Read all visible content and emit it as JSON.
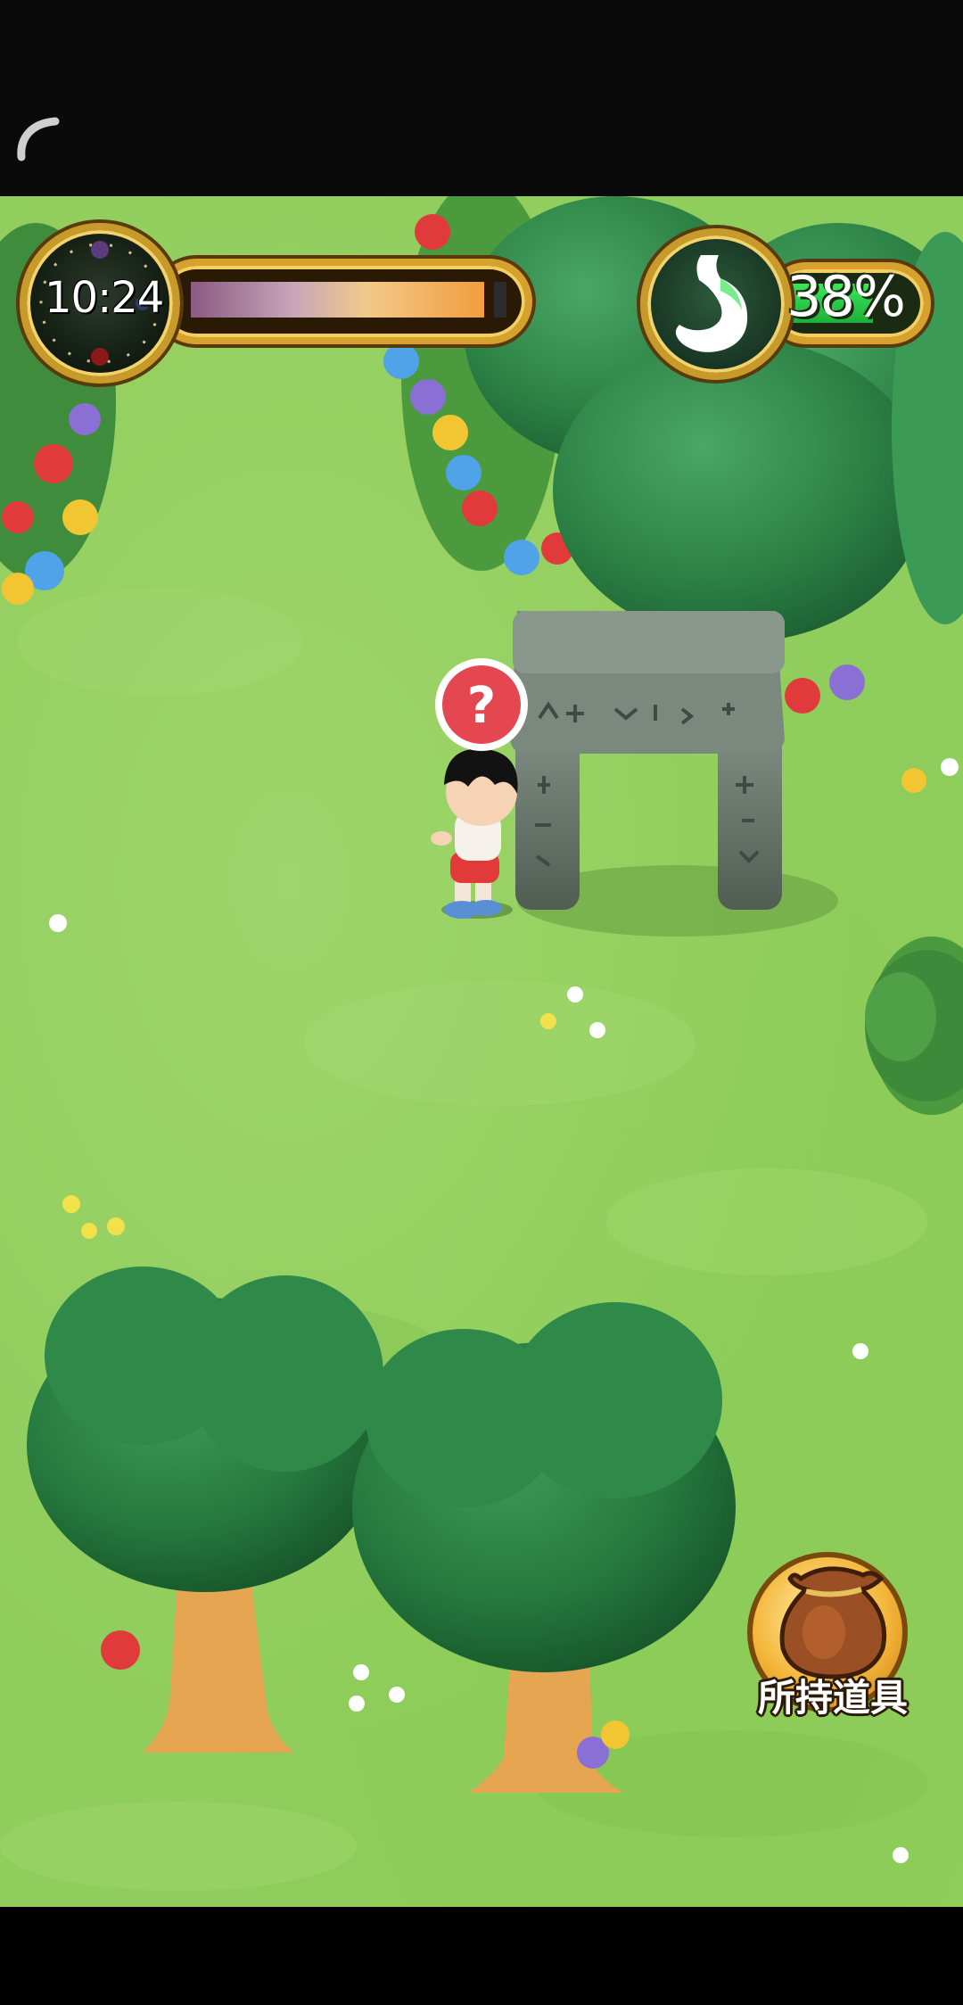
{
  "hud": {
    "time": "10:24",
    "day_progress": 0.95,
    "hunger_percent": "38%",
    "hunger_level": 0.38
  },
  "inventory": {
    "label": "所持道具"
  },
  "icons": {
    "loading": "loading-arc-icon",
    "clock": "clock-icon",
    "stomach": "stomach-icon",
    "bag": "item-bag-icon",
    "question": "question-mark-icon"
  },
  "colors": {
    "grass": "#8fcd5c",
    "tree_canopy": "#2f8a4a",
    "tree_trunk": "#e6a551",
    "stone": "#5f6e63",
    "hud_gold": "#d6a22d",
    "hunger_green": "#2ecc4a",
    "question_red": "#e4474f"
  }
}
